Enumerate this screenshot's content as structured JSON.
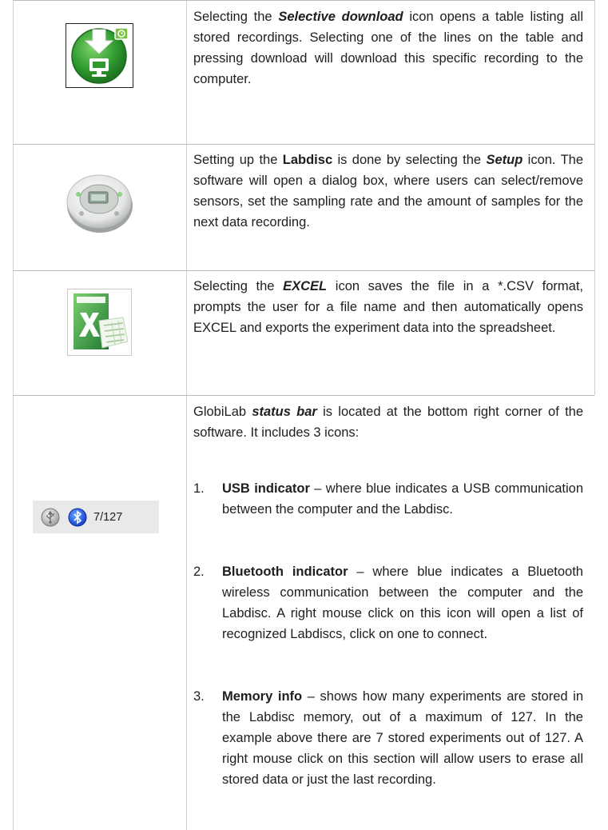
{
  "rows": [
    {
      "icon": "selective-download-icon",
      "segments": [
        {
          "t": "Selecting the ",
          "s": ""
        },
        {
          "t": "Selective download",
          "s": "bi"
        },
        {
          "t": " icon opens a table listing all stored recordings. Selecting one of the lines on the table and pressing download will download this specific recording to the computer.",
          "s": ""
        }
      ]
    },
    {
      "icon": "labdisc-device-icon",
      "segments": [
        {
          "t": "Setting up the ",
          "s": ""
        },
        {
          "t": "Labdisc",
          "s": "b"
        },
        {
          "t": " is done by selecting the ",
          "s": ""
        },
        {
          "t": "Setup",
          "s": "bi"
        },
        {
          "t": " icon. The software will open a dialog box, where users can select/remove sensors, set the sampling rate and the amount of samples for the next data recording.",
          "s": ""
        }
      ]
    },
    {
      "icon": "excel-icon",
      "segments": [
        {
          "t": "Selecting the ",
          "s": ""
        },
        {
          "t": "EXCEL",
          "s": "bi"
        },
        {
          "t": " icon saves the file in a *.CSV format, prompts the user for a file name and then automatically opens EXCEL and exports the experiment data into the spreadsheet.",
          "s": ""
        }
      ]
    },
    {
      "icon": "status-bar-icon",
      "status_text": "7/127",
      "segments": [
        {
          "t": "GlobiLab ",
          "s": ""
        },
        {
          "t": "status bar",
          "s": "bi"
        },
        {
          "t": " is located at the bottom right corner of the software. It includes 3 icons:",
          "s": ""
        }
      ],
      "list": [
        {
          "num": "1.",
          "segments": [
            {
              "t": "USB indicator",
              "s": "b"
            },
            {
              "t": " – where blue indicates a USB communication between the computer and the Labdisc.",
              "s": ""
            }
          ]
        },
        {
          "num": "2.",
          "segments": [
            {
              "t": "Bluetooth indicator",
              "s": "b"
            },
            {
              "t": " – where blue indicates a Bluetooth wireless communication between the computer and the Labdisc. A right mouse click on this icon will open a list of recognized Labdiscs, click on one to connect.",
              "s": ""
            }
          ]
        },
        {
          "num": "3.",
          "segments": [
            {
              "t": "Memory info",
              "s": "b"
            },
            {
              "t": " – shows how many experiments are stored in the Labdisc memory, out of a maximum of 127. In the example above there are 7 stored experiments out of 127. A right mouse click on this section will allow users to erase all stored data or just the last recording.",
              "s": ""
            }
          ]
        }
      ]
    }
  ]
}
